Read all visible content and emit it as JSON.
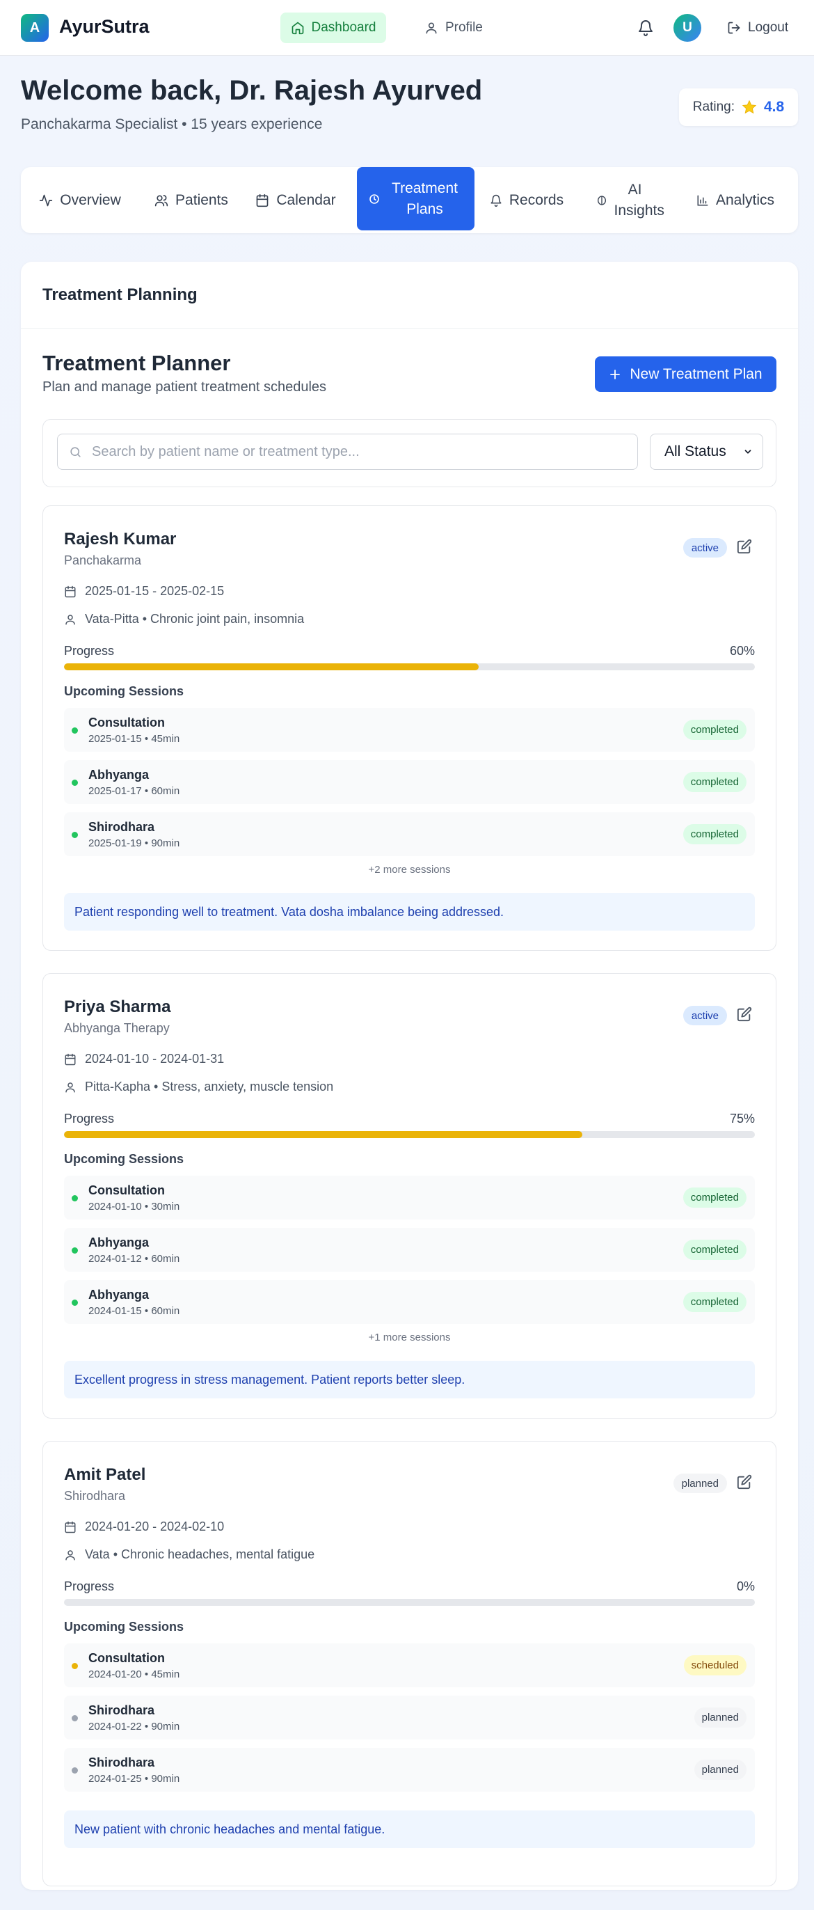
{
  "brand": {
    "logo_letter": "A",
    "name": "AyurSutra"
  },
  "nav": {
    "dashboard": "Dashboard",
    "profile": "Profile",
    "avatar_letter": "U",
    "logout": "Logout"
  },
  "welcome": {
    "title": "Welcome back, Dr. Rajesh Ayurved",
    "subtitle": "Panchakarma Specialist • 15 years experience",
    "rating_label": "Rating:",
    "rating_value": "4.8"
  },
  "tabs": [
    {
      "label": "Overview",
      "icon": "activity-icon"
    },
    {
      "label": "Patients",
      "icon": "users-icon"
    },
    {
      "label": "Calendar",
      "icon": "calendar-icon"
    },
    {
      "label": "Treatment Plans",
      "icon": "clock-icon",
      "active": true
    },
    {
      "label": "Records",
      "icon": "bell-icon"
    },
    {
      "label": "AI Insights",
      "icon": "brain-icon"
    },
    {
      "label": "Analytics",
      "icon": "bar-chart-icon"
    }
  ],
  "panel": {
    "title": "Treatment Planning",
    "planner_title": "Treatment Planner",
    "planner_subtitle": "Plan and manage patient treatment schedules",
    "new_plan_label": "New Treatment Plan",
    "search_placeholder": "Search by patient name or treatment type...",
    "status_filter": "All Status"
  },
  "colors": {
    "accent": "#2563eb",
    "progress": "#eab308",
    "completed_dot": "#22c55e",
    "scheduled_dot": "#eab308",
    "planned_dot": "#9ca3af"
  },
  "plans": [
    {
      "patient": "Rajesh Kumar",
      "treatment": "Panchakarma",
      "status": "active",
      "dates": "2025-01-15 - 2025-02-15",
      "dosha_condition": "Vata-Pitta • Chronic joint pain, insomnia",
      "progress_label": "Progress",
      "progress_value": "60%",
      "progress_fraction": 0.6,
      "upcoming_label": "Upcoming Sessions",
      "sessions": [
        {
          "name": "Consultation",
          "meta": "2025-01-15 • 45min",
          "status": "completed"
        },
        {
          "name": "Abhyanga",
          "meta": "2025-01-17 • 60min",
          "status": "completed"
        },
        {
          "name": "Shirodhara",
          "meta": "2025-01-19 • 90min",
          "status": "completed"
        }
      ],
      "more": "+2 more sessions",
      "note": "Patient responding well to treatment. Vata dosha imbalance being addressed."
    },
    {
      "patient": "Priya Sharma",
      "treatment": "Abhyanga Therapy",
      "status": "active",
      "dates": "2024-01-10 - 2024-01-31",
      "dosha_condition": "Pitta-Kapha • Stress, anxiety, muscle tension",
      "progress_label": "Progress",
      "progress_value": "75%",
      "progress_fraction": 0.75,
      "upcoming_label": "Upcoming Sessions",
      "sessions": [
        {
          "name": "Consultation",
          "meta": "2024-01-10 • 30min",
          "status": "completed"
        },
        {
          "name": "Abhyanga",
          "meta": "2024-01-12 • 60min",
          "status": "completed"
        },
        {
          "name": "Abhyanga",
          "meta": "2024-01-15 • 60min",
          "status": "completed"
        }
      ],
      "more": "+1 more sessions",
      "note": "Excellent progress in stress management. Patient reports better sleep."
    },
    {
      "patient": "Amit Patel",
      "treatment": "Shirodhara",
      "status": "planned",
      "dates": "2024-01-20 - 2024-02-10",
      "dosha_condition": "Vata • Chronic headaches, mental fatigue",
      "progress_label": "Progress",
      "progress_value": "0%",
      "progress_fraction": 0,
      "upcoming_label": "Upcoming Sessions",
      "sessions": [
        {
          "name": "Consultation",
          "meta": "2024-01-20 • 45min",
          "status": "scheduled"
        },
        {
          "name": "Shirodhara",
          "meta": "2024-01-22 • 90min",
          "status": "planned"
        },
        {
          "name": "Shirodhara",
          "meta": "2024-01-25 • 90min",
          "status": "planned"
        }
      ],
      "more": "",
      "note": "New patient with chronic headaches and mental fatigue."
    }
  ]
}
